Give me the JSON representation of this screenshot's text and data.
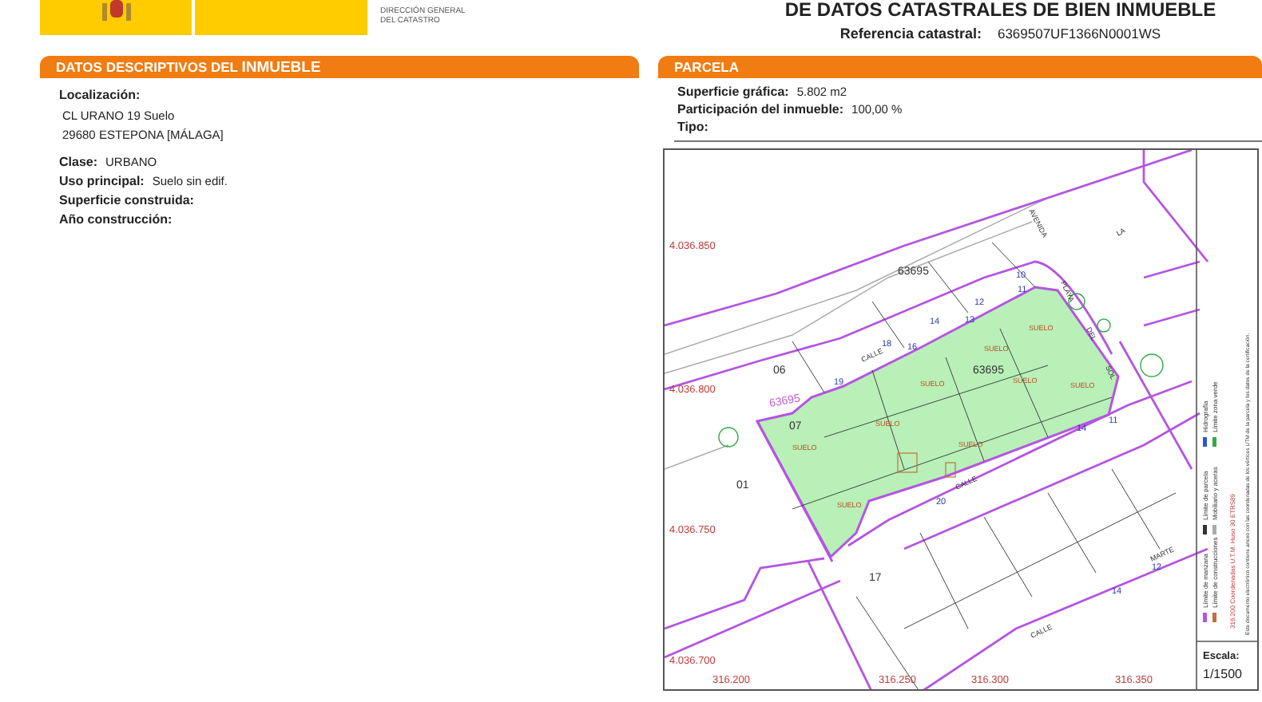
{
  "header": {
    "agency_lines": [
      "DIRECCIÓN GENERAL",
      "DEL CATASTRO"
    ],
    "title": "DE DATOS CATASTRALES DE BIEN INMUEBLE",
    "reference_label": "Referencia catastral:",
    "reference": "6369507UF1366N0001WS"
  },
  "inmueble": {
    "title": "DATOS DESCRIPTIVOS DEL **INMUEBLE**",
    "location_label": "Localización:",
    "address": [
      "CL URANO 19 Suelo",
      "29680 ESTEPONA [MÁLAGA]"
    ],
    "fields": [
      {
        "label": "Clase:",
        "value": "URBANO"
      },
      {
        "label": "Uso principal:",
        "value": "Suelo sin edif."
      },
      {
        "label": "Superficie construida:"
      },
      {
        "label": "Año construcción:"
      }
    ]
  },
  "parcela": {
    "title": "PARCELA",
    "fields": [
      {
        "label": "Superficie gráfica:",
        "value": "5.802 m2"
      },
      {
        "label": "Participación del inmueble:",
        "value": "100,00 %"
      },
      {
        "label": "Tipo:"
      }
    ],
    "map": {
      "labels": [
        {
          "text": "63695",
          "kind": "parcel"
        },
        {
          "text": "06",
          "kind": "parcel"
        },
        {
          "text": "63695",
          "kind": "parcel"
        },
        {
          "text": "63695",
          "kind": "block"
        },
        {
          "text": "07",
          "kind": "parcel"
        },
        {
          "text": "01",
          "kind": "parcel"
        },
        {
          "text": "17",
          "kind": "parcel"
        },
        {
          "text": "SUELO",
          "kind": "subparcel"
        },
        {
          "text": "SUELO",
          "kind": "subparcel"
        },
        {
          "text": "SUELO",
          "kind": "subparcel"
        },
        {
          "text": "SUELO",
          "kind": "subparcel"
        },
        {
          "text": "SUELO",
          "kind": "subparcel"
        },
        {
          "text": "SUELO",
          "kind": "subparcel"
        },
        {
          "text": "SUELO",
          "kind": "subparcel"
        },
        {
          "text": "SUELO",
          "kind": "subparcel"
        },
        {
          "text": "SUELO",
          "kind": "subparcel"
        },
        {
          "text": "4.036.850",
          "kind": "coordinate"
        },
        {
          "text": "4.036.800",
          "kind": "coordinate"
        },
        {
          "text": "4.036.750",
          "kind": "coordinate"
        },
        {
          "text": "4.036.700",
          "kind": "coordinate"
        },
        {
          "text": "316.200",
          "kind": "coordinate"
        },
        {
          "text": "316.250",
          "kind": "coordinate"
        },
        {
          "text": "316.300",
          "kind": "coordinate"
        },
        {
          "text": "316.350",
          "kind": "coordinate"
        },
        {
          "text": "CALLE",
          "kind": "street"
        },
        {
          "text": "AVENIDA",
          "kind": "street"
        },
        {
          "text": "PLAYA",
          "kind": "street"
        },
        {
          "text": "DEL",
          "kind": "street"
        },
        {
          "text": "SOL",
          "kind": "street"
        },
        {
          "text": "LA",
          "kind": "street"
        },
        {
          "text": "CALLE",
          "kind": "street"
        },
        {
          "text": "CALLE",
          "kind": "street"
        },
        {
          "text": "MARTE",
          "kind": "street"
        },
        {
          "text": "10",
          "kind": "number"
        },
        {
          "text": "11",
          "kind": "number"
        },
        {
          "text": "12",
          "kind": "number"
        },
        {
          "text": "14",
          "kind": "number"
        },
        {
          "text": "13",
          "kind": "number"
        },
        {
          "text": "18",
          "kind": "number"
        },
        {
          "text": "16",
          "kind": "number"
        },
        {
          "text": "19",
          "kind": "number"
        },
        {
          "text": "14",
          "kind": "number"
        },
        {
          "text": "11",
          "kind": "number"
        },
        {
          "text": "20",
          "kind": "number"
        },
        {
          "text": "12",
          "kind": "number"
        },
        {
          "text": "14",
          "kind": "number"
        }
      ],
      "legend": [
        {
          "label": "Límite de manzana",
          "color": "#b455e0"
        },
        {
          "label": "Límite de parcela",
          "color": "#333333"
        },
        {
          "label": "Hidrografía",
          "color": "#3355cc"
        },
        {
          "label": "Límite de construcciones",
          "color": "#c0703a"
        },
        {
          "label": "Mobiliario y aceras",
          "color": "#aaaaaa"
        },
        {
          "label": "Límite zona verde",
          "color": "#33aa44"
        }
      ],
      "coords_note": "316.200 Coordenadas U.T.M. Huso 30 ETRS89",
      "doc_note": "Este documento electrónico contiene anexo con las coordenadas de los vértices UTM de la parcela y los datos de la certificación.",
      "scale_label": "Escala:",
      "scale": "1/1500"
    }
  }
}
